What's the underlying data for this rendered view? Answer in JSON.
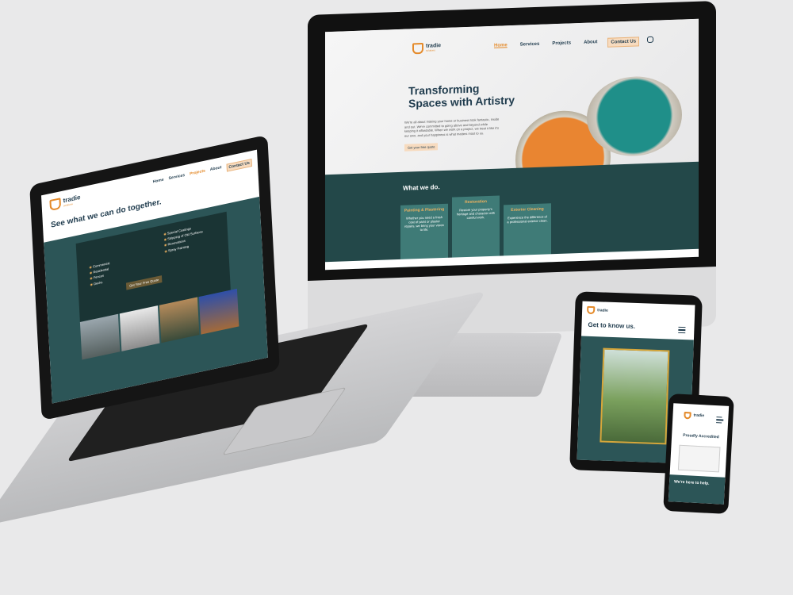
{
  "brand": {
    "name": "tradie",
    "sub": "solutions"
  },
  "imac_site": {
    "nav": [
      "Home",
      "Services",
      "Projects",
      "About"
    ],
    "contact_label": "Contact Us",
    "hero_title_1": "Transforming",
    "hero_title_2": "Spaces with Artistry",
    "hero_copy": "We're all about making your home or business look fantastic, inside and out. We're committed to going above and beyond while keeping it affordable. When we work on a project, we treat it like it's our own, and your happiness is what matters most to us.",
    "hero_button": "Get your free quote",
    "section_title": "What we do.",
    "cards": [
      {
        "title": "Painting & Plastering",
        "text": "Whether you need a fresh coat of paint or plaster repairs, we bring your vision to life."
      },
      {
        "title": "Restoration",
        "text": "Restore your property's heritage and character with careful work."
      },
      {
        "title": "Exterior Cleaning",
        "text": "Experience the difference of a professional exterior clean."
      }
    ]
  },
  "laptop_site": {
    "nav": [
      "Home",
      "Services",
      "Projects",
      "About"
    ],
    "contact_label": "Contact Us",
    "title": "See what we can do together.",
    "list_left": [
      "Commercial",
      "Residential",
      "Fences",
      "Decks"
    ],
    "list_right": [
      "Special Coatings",
      "Stripping of Old Surfaces",
      "Renovations",
      "Spray Painting"
    ],
    "button": "Get Your Free Quote"
  },
  "tablet_site": {
    "title": "Get to know us."
  },
  "phone_site": {
    "accredited": "Proudly Accredited",
    "help": "We're here to help."
  },
  "colors": {
    "navy": "#1f3b4d",
    "teal_dark": "#234849",
    "teal": "#2c5557",
    "orange": "#e98531"
  }
}
